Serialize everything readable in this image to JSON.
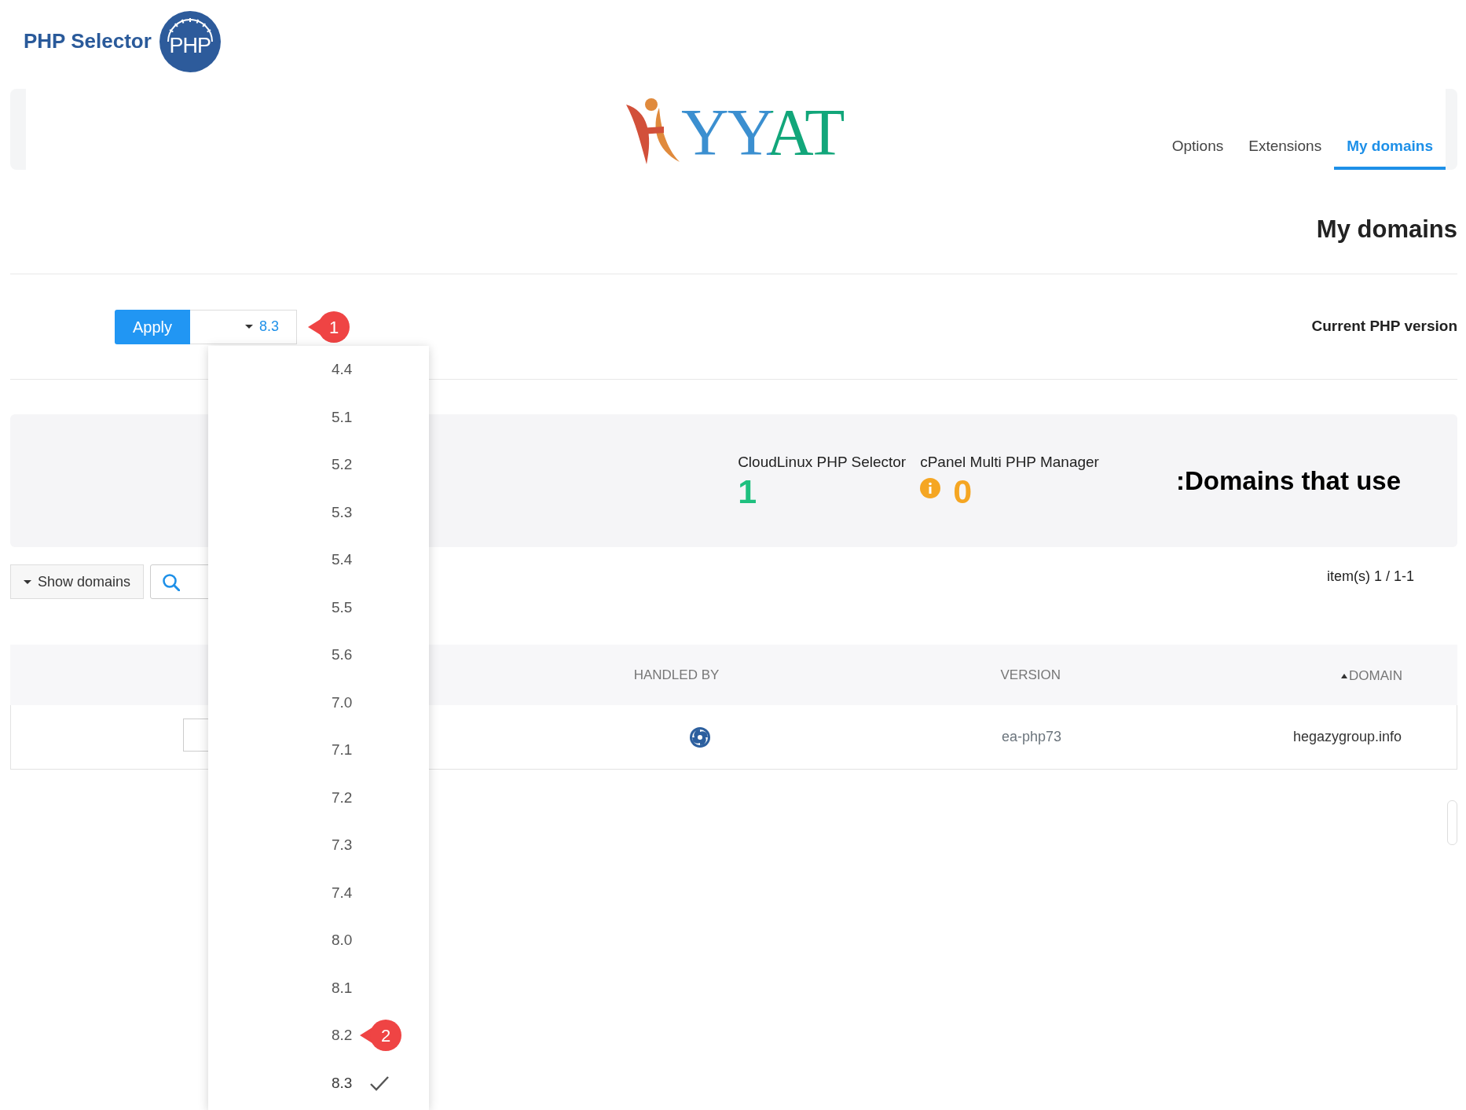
{
  "header": {
    "title": "PHP Selector",
    "logo_text": "PHP"
  },
  "brand": {
    "text": "YYAT"
  },
  "tabs": [
    {
      "label": "Options",
      "selected": false
    },
    {
      "label": "Extensions",
      "selected": false
    },
    {
      "label": "My domains",
      "selected": true
    }
  ],
  "heading": "My domains",
  "apply_button": "Apply",
  "version_dropdown": {
    "value": "8.3",
    "callout": "1"
  },
  "current_label": "Current PHP version",
  "stats": {
    "title": ":Domains that use",
    "sources": [
      {
        "label": "CloudLinux PHP Selector",
        "count": "1",
        "color": "#1fc07f",
        "info": false
      },
      {
        "label": "cPanel Multi PHP Manager",
        "count": "0",
        "color": "#f5a623",
        "info": true
      }
    ]
  },
  "toolbar": {
    "show_button": "Show domains",
    "items_count": "item(s) 1 / 1-1"
  },
  "table": {
    "columns": [
      {
        "label": "HANDLED BY",
        "sorted": false
      },
      {
        "label": "VERSION",
        "sorted": false
      },
      {
        "label": "DOMAIN",
        "sorted": true
      }
    ],
    "rows": [
      {
        "version": "ea-php73",
        "domain": "hegazygroup.info"
      }
    ]
  },
  "versions_menu": [
    {
      "label": "4.4",
      "selected": false
    },
    {
      "label": "5.1",
      "selected": false
    },
    {
      "label": "5.2",
      "selected": false
    },
    {
      "label": "5.3",
      "selected": false
    },
    {
      "label": "5.4",
      "selected": false
    },
    {
      "label": "5.5",
      "selected": false
    },
    {
      "label": "5.6",
      "selected": false
    },
    {
      "label": "7.0",
      "selected": false
    },
    {
      "label": "7.1",
      "selected": false
    },
    {
      "label": "7.2",
      "selected": false
    },
    {
      "label": "7.3",
      "selected": false
    },
    {
      "label": "7.4",
      "selected": false
    },
    {
      "label": "8.0",
      "selected": false
    },
    {
      "label": "8.1",
      "selected": false
    },
    {
      "label": "8.2",
      "selected": false,
      "callout": "2"
    },
    {
      "label": "8.3",
      "selected": true
    }
  ]
}
